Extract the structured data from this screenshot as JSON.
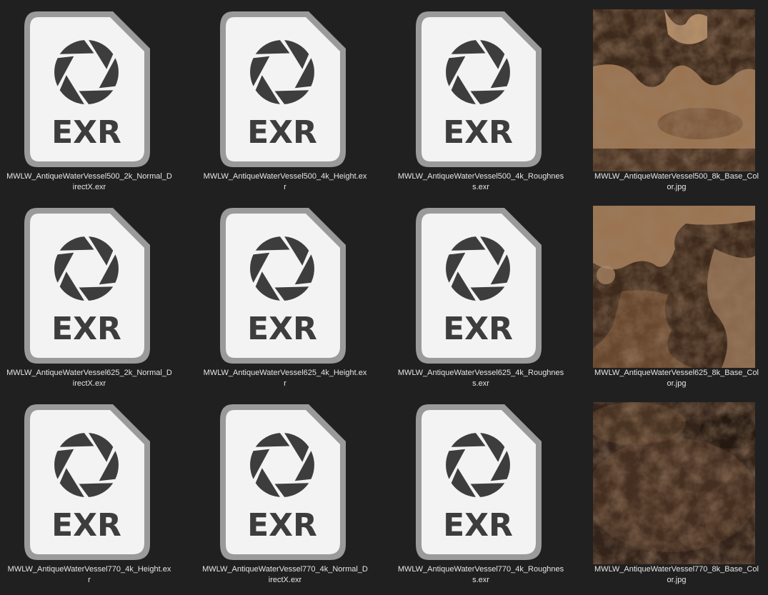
{
  "icon_text": "EXR",
  "files": [
    {
      "type": "exr",
      "icon": "aperture-icon",
      "name_lines": [
        "MWLW_AntiqueWaterVessel500_2k_Normal_D",
        "irectX.exr"
      ]
    },
    {
      "type": "exr",
      "icon": "aperture-icon",
      "name_lines": [
        "MWLW_AntiqueWaterVessel500_4k_Height.ex",
        "r"
      ]
    },
    {
      "type": "exr",
      "icon": "aperture-icon",
      "name_lines": [
        "MWLW_AntiqueWaterVessel500_4k_Roughnes",
        "s.exr"
      ]
    },
    {
      "type": "jpg",
      "variant": 0,
      "name_lines": [
        "MWLW_AntiqueWaterVessel500_8k_Base_Col",
        "or.jpg"
      ]
    },
    {
      "type": "exr",
      "icon": "aperture-icon",
      "name_lines": [
        "MWLW_AntiqueWaterVessel625_2k_Normal_D",
        "irectX.exr"
      ]
    },
    {
      "type": "exr",
      "icon": "aperture-icon",
      "name_lines": [
        "MWLW_AntiqueWaterVessel625_4k_Height.ex",
        "r"
      ]
    },
    {
      "type": "exr",
      "icon": "aperture-icon",
      "name_lines": [
        "MWLW_AntiqueWaterVessel625_4k_Roughnes",
        "s.exr"
      ]
    },
    {
      "type": "jpg",
      "variant": 1,
      "name_lines": [
        "MWLW_AntiqueWaterVessel625_8k_Base_Col",
        "or.jpg"
      ]
    },
    {
      "type": "exr",
      "icon": "aperture-icon",
      "name_lines": [
        "MWLW_AntiqueWaterVessel770_4k_Height.ex",
        "r"
      ]
    },
    {
      "type": "exr",
      "icon": "aperture-icon",
      "name_lines": [
        "MWLW_AntiqueWaterVessel770_4k_Normal_D",
        "irectX.exr"
      ]
    },
    {
      "type": "exr",
      "icon": "aperture-icon",
      "name_lines": [
        "MWLW_AntiqueWaterVessel770_4k_Roughnes",
        "s.exr"
      ]
    },
    {
      "type": "jpg",
      "variant": 2,
      "name_lines": [
        "MWLW_AntiqueWaterVessel770_8k_Base_Col",
        "or.jpg"
      ]
    }
  ],
  "colors": {
    "background": "#202020",
    "doc_fill": "#f3f3f3",
    "doc_border": "#9a9a9a",
    "icon_dark": "#3d3d3d",
    "label_text": "#e6e6e6"
  }
}
